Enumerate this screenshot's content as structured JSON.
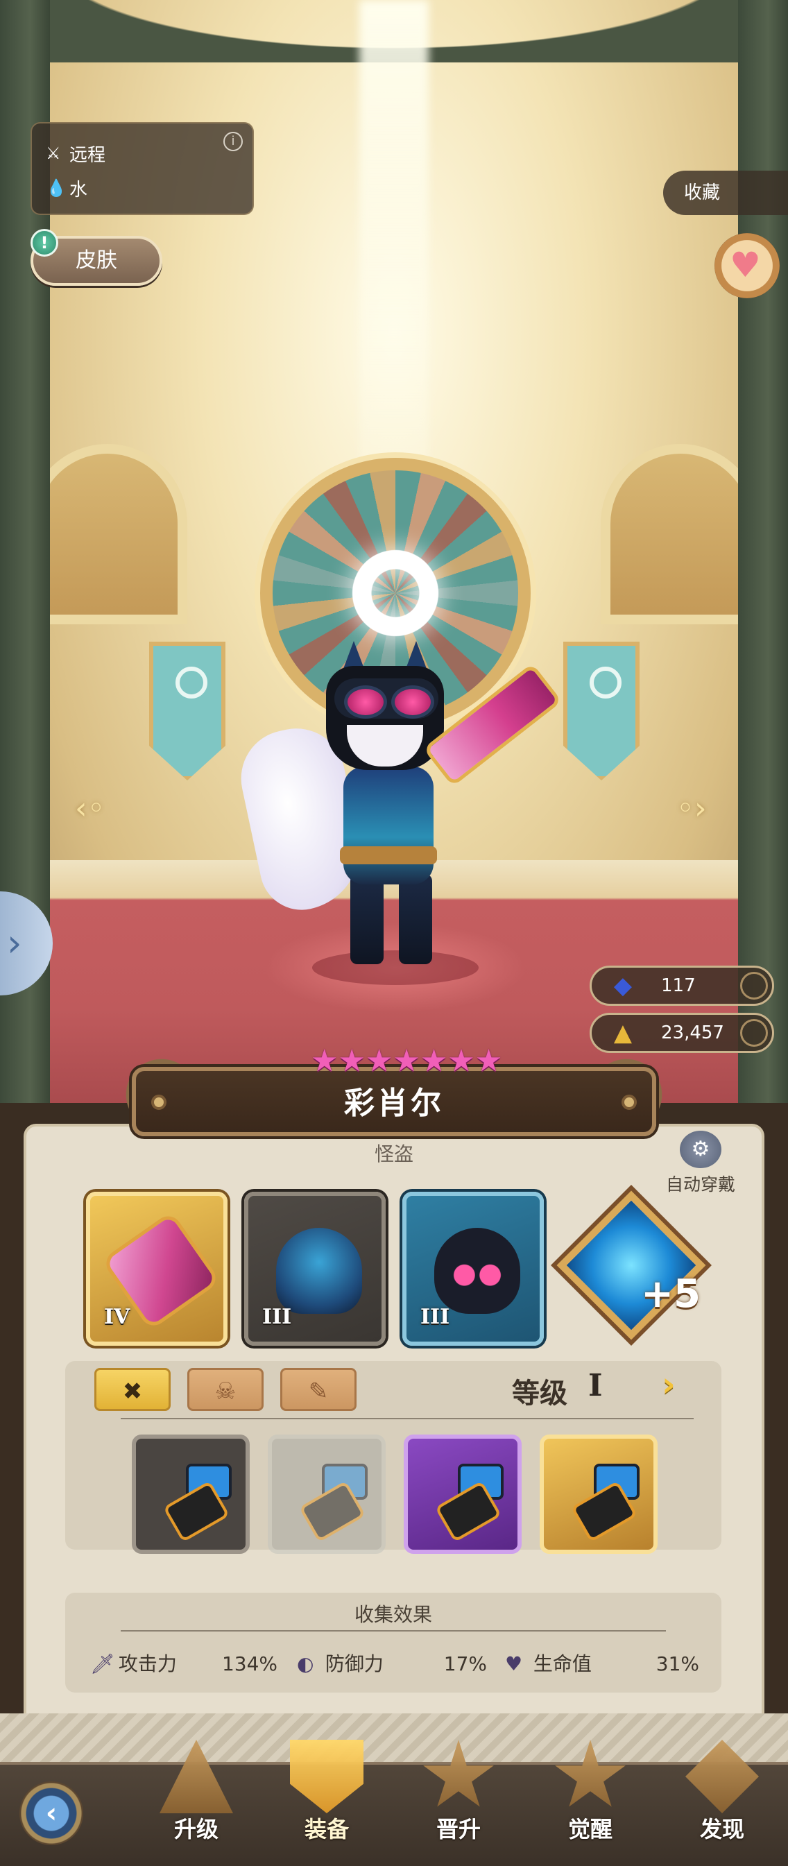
{
  "hero": {
    "attack_type": "远程",
    "element": "水",
    "name": "彩肖尔",
    "class": "怪盗",
    "stars": 7
  },
  "buttons": {
    "skin": "皮肤",
    "favorite": "收藏",
    "auto_equip": "自动穿戴"
  },
  "currency": {
    "gems": "117",
    "gold": "23,457"
  },
  "equipment": {
    "weapon_tier": "IV",
    "armor_tier": "III",
    "helmet_tier": "III",
    "core_bonus": "+5"
  },
  "grade_panel": {
    "level_label": "等级",
    "level_value": "I",
    "filter_tabs": [
      "weapon-filter",
      "accessory-filter",
      "misc-filter"
    ]
  },
  "collection": {
    "title": "收集效果",
    "stats": [
      {
        "label": "攻击力",
        "value": "134%"
      },
      {
        "label": "防御力",
        "value": "17%"
      },
      {
        "label": "生命值",
        "value": "31%"
      }
    ]
  },
  "nav": {
    "items": [
      {
        "label": "升级"
      },
      {
        "label": "装备"
      },
      {
        "label": "晋升"
      },
      {
        "label": "觉醒"
      },
      {
        "label": "发现"
      }
    ],
    "active": "装备"
  },
  "icons": {
    "ranged": "crossed-arrows-icon",
    "water": "water-drop-icon",
    "heart": "heart-icon",
    "gem": "blue-gem-icon",
    "gold": "gold-pile-icon"
  },
  "colors": {
    "star": "#f15fb8",
    "panel": "#e6decd",
    "active_tab": "#f6d465"
  }
}
